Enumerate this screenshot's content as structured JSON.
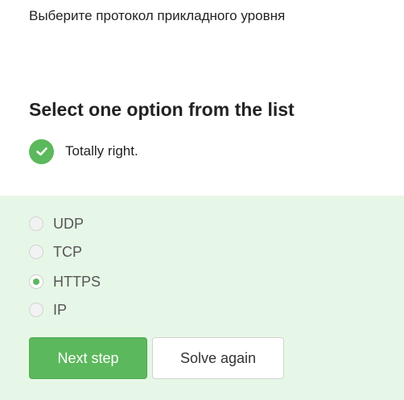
{
  "question": {
    "text": "Выберите протокол прикладного уровня"
  },
  "quiz": {
    "instruction": "Select one option from the list",
    "feedback": "Totally right.",
    "options": [
      {
        "label": "UDP",
        "selected": false
      },
      {
        "label": "TCP",
        "selected": false
      },
      {
        "label": "HTTPS",
        "selected": true
      },
      {
        "label": "IP",
        "selected": false
      }
    ],
    "next_label": "Next step",
    "solve_again_label": "Solve again"
  },
  "colors": {
    "accent": "#5cb85c",
    "panel_background": "#e7f7e7"
  },
  "icons": {
    "feedback": "check-circle-icon"
  }
}
